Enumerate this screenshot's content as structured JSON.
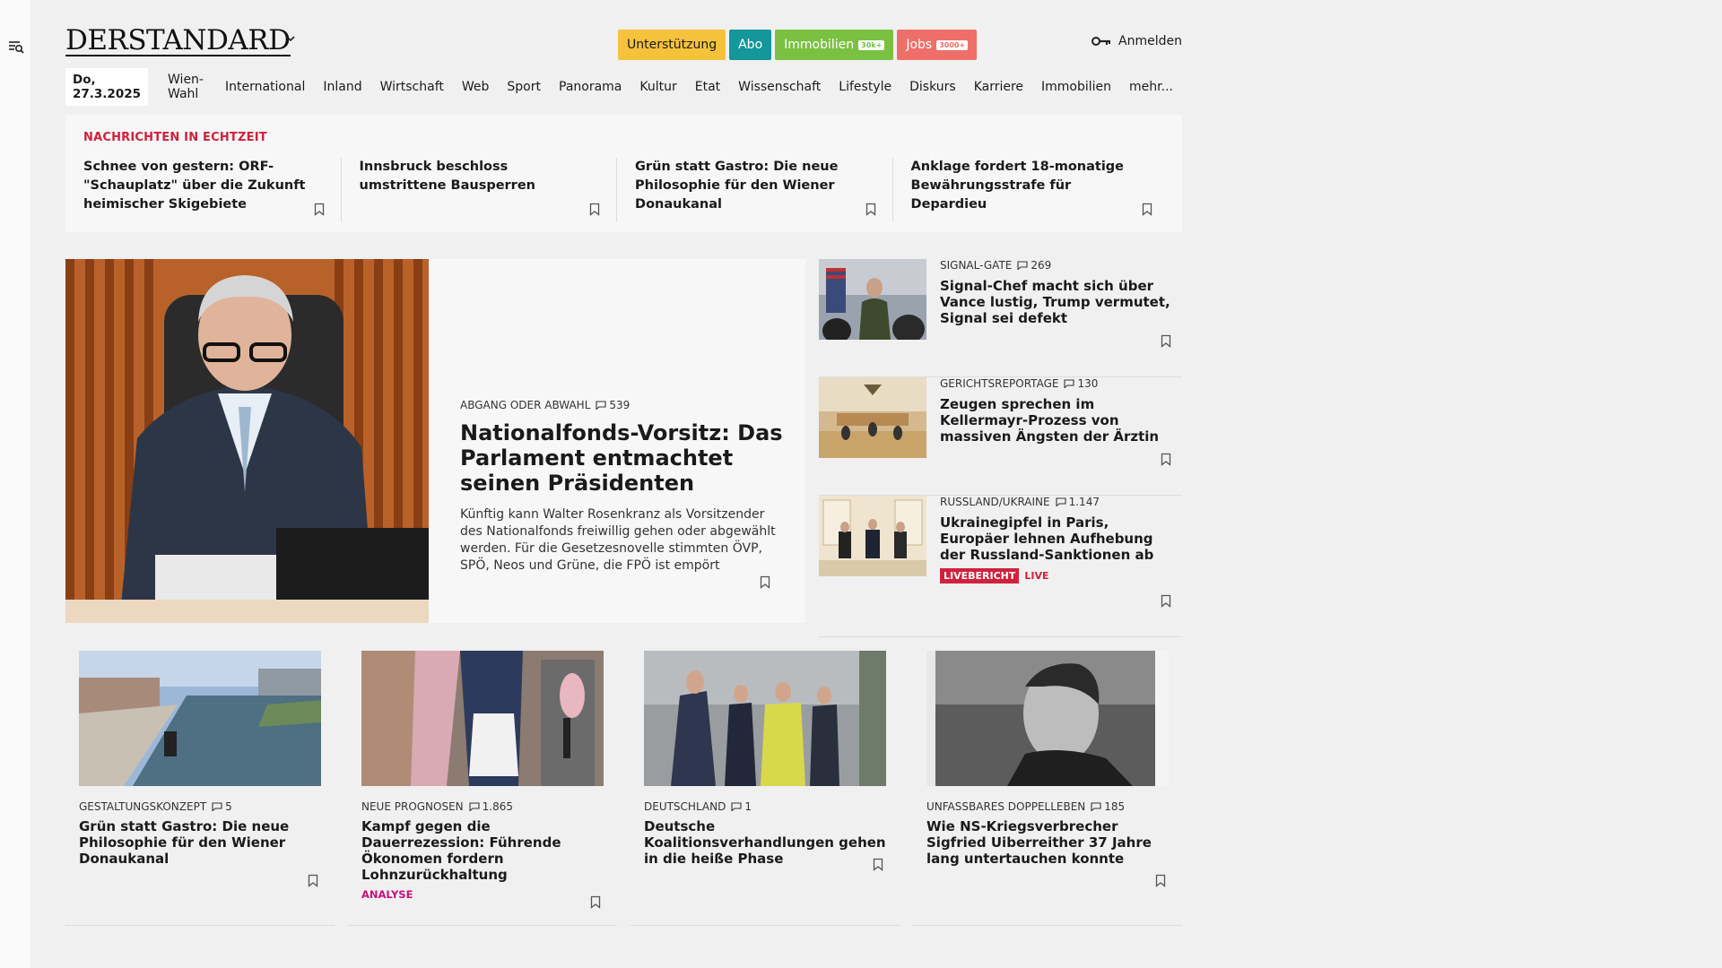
{
  "header": {
    "logo": "DERSTANDARD",
    "pills": [
      {
        "label": "Unterstützung",
        "bg": "#f5c23c",
        "fg": "#1a1a1a",
        "tag": ""
      },
      {
        "label": "Abo",
        "bg": "#14969a",
        "fg": "#ffffff",
        "tag": ""
      },
      {
        "label": "Immobilien",
        "bg": "#7ac142",
        "fg": "#ffffff",
        "tag": "30k+"
      },
      {
        "label": "Jobs",
        "bg": "#ee6f6a",
        "fg": "#ffffff",
        "tag": "3000+"
      }
    ],
    "login": "Anmelden"
  },
  "nav": {
    "date": "Do, 27.3.2025",
    "items": [
      "Wien-Wahl",
      "International",
      "Inland",
      "Wirtschaft",
      "Web",
      "Sport",
      "Panorama",
      "Kultur",
      "Etat",
      "Wissenschaft",
      "Lifestyle",
      "Diskurs",
      "Karriere",
      "Immobilien",
      "mehr..."
    ]
  },
  "ticker": {
    "title": "NACHRICHTEN IN ECHTZEIT",
    "items": [
      "Schnee von gestern: ORF-\"Schauplatz\" über die Zukunft heimischer Skigebiete",
      "Innsbruck beschloss umstrittene Bausperren",
      "Grün statt Gastro: Die neue Philosophie für den Wiener Donaukanal",
      "Anklage fordert 18-monatige Bewährungsstrafe für Depardieu"
    ]
  },
  "hero": {
    "kicker": "ABGANG ODER ABWAHL",
    "comments": "539",
    "title": "Nationalfonds-Vorsitz: Das Parlament entmachtet seinen Präsidenten",
    "lead": "Künftig kann Walter Rosenkranz als Vorsitzender des Nationalfonds freiwillig gehen oder abgewählt werden. Für die Gesetzesnovelle stimmten ÖVP, SPÖ, Neos und Grüne, die FPÖ ist empört"
  },
  "side": [
    {
      "kicker": "SIGNAL-GATE",
      "comments": "269",
      "title": "Signal-Chef macht sich über Vance lustig, Trump vermutet, Signal sei defekt"
    },
    {
      "kicker": "GERICHTSREPORTAGE",
      "comments": "130",
      "title": "Zeugen sprechen im Kellermayr-Prozess von massiven Ängsten der Ärztin"
    },
    {
      "kicker": "RUSSLAND/UKRAINE",
      "comments": "1.147",
      "title": "Ukrainegipfel in Paris, Europäer lehnen Aufhebung der Russland-Sanktionen ab",
      "badge": "LIVEBERICHT",
      "live": "LIVE"
    }
  ],
  "cards": [
    {
      "kicker": "GESTALTUNGSKONZEPT",
      "comments": "5",
      "title": "Grün statt Gastro: Die neue Philosophie für den Wiener Donaukanal",
      "tag": ""
    },
    {
      "kicker": "NEUE PROGNOSEN",
      "comments": "1.865",
      "title": "Kampf gegen die Dauerrezession: Führende Ökonomen fordern Lohnzurückhaltung",
      "tag": "ANALYSE"
    },
    {
      "kicker": "DEUTSCHLAND",
      "comments": "1",
      "title": "Deutsche Koalitionsverhandlungen gehen in die heiße Phase",
      "tag": ""
    },
    {
      "kicker": "UNFASSBARES DOPPELLEBEN",
      "comments": "185",
      "title": "Wie NS-Kriegsverbrecher Sigfried Uiberreither 37 Jahre lang untertauchen konnte",
      "tag": ""
    }
  ]
}
